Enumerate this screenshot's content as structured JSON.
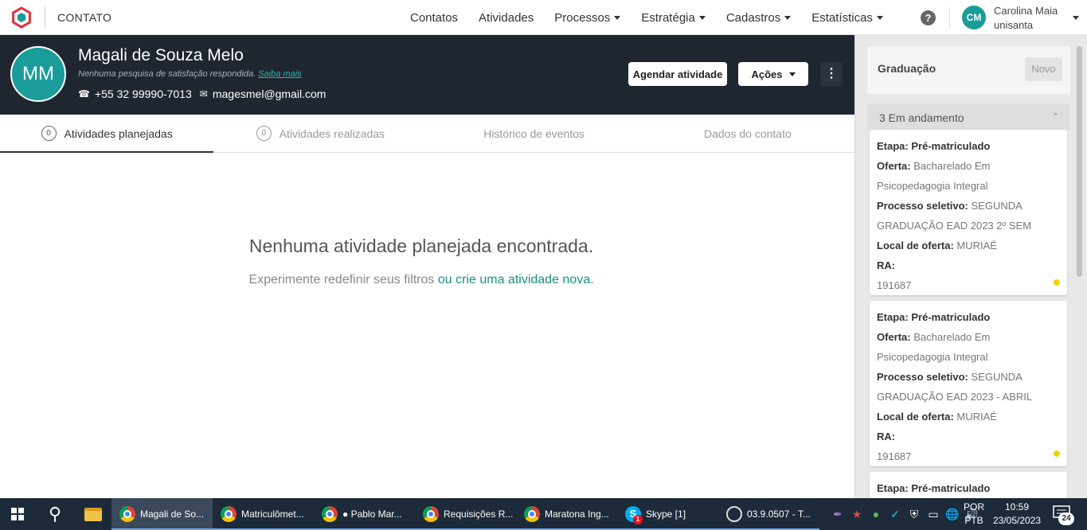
{
  "app": {
    "title": "CONTATO"
  },
  "nav": {
    "items": [
      {
        "label": "Contatos",
        "has_caret": false
      },
      {
        "label": "Atividades",
        "has_caret": false
      },
      {
        "label": "Processos",
        "has_caret": true
      },
      {
        "label": "Estratégia",
        "has_caret": true
      },
      {
        "label": "Cadastros",
        "has_caret": true
      },
      {
        "label": "Estatísticas",
        "has_caret": true
      }
    ],
    "help_glyph": "?"
  },
  "user": {
    "initials": "CM",
    "name": "Carolina Maia",
    "org": "unisanta"
  },
  "contact": {
    "initials": "MM",
    "name": "Magali de Souza Melo",
    "survey_text": "Nenhuma pesquisa de satisfação respondida.",
    "survey_link": "Saiba mais",
    "phone": "+55 32 99990-7013",
    "email": "magesmel@gmail.com",
    "schedule_button": "Agendar atividade",
    "actions_button": "Ações"
  },
  "tabs": [
    {
      "count": "0",
      "label": "Atividades planejadas",
      "active": true
    },
    {
      "count": "0",
      "label": "Atividades realizadas",
      "active": false
    },
    {
      "count": "",
      "label": "Histórico de eventos",
      "active": false
    },
    {
      "count": "",
      "label": "Dados do contato",
      "active": false
    }
  ],
  "empty_state": {
    "title": "Nenhuma atividade planejada encontrada.",
    "subtitle": "Experimente redefinir seus filtros",
    "link": "ou crie uma atividade nova."
  },
  "panel": {
    "title": "Graduação",
    "new_button": "Novo",
    "status": "3 Em andamento",
    "cards": [
      {
        "stage_label": "Etapa:",
        "stage": "Pré-matriculado",
        "offer_label": "Oferta:",
        "offer": "Bacharelado Em Psicopedagogia Integral",
        "process_label": "Processo seletivo:",
        "process": "SEGUNDA GRADUAÇÃO EAD 2023 2º SEM",
        "place_label": "Local de oferta:",
        "place": "MURIAÉ",
        "ra_label": "RA:",
        "ra": "191687"
      },
      {
        "stage_label": "Etapa:",
        "stage": "Pré-matriculado",
        "offer_label": "Oferta:",
        "offer": "Bacharelado Em Psicopedagogia Integral",
        "process_label": "Processo seletivo:",
        "process": "SEGUNDA GRADUAÇÃO EAD 2023 - ABRIL",
        "place_label": "Local de oferta:",
        "place": "MURIAÉ",
        "ra_label": "RA:",
        "ra": "191687"
      },
      {
        "stage_label": "Etapa:",
        "stage": "Pré-matriculado"
      }
    ]
  },
  "taskbar": {
    "apps": [
      {
        "icon": "chrome-icon",
        "label": "Magali de So...",
        "active": true
      },
      {
        "icon": "chrome-icon",
        "label": "Matriculômet...",
        "active": false
      },
      {
        "icon": "chrome-icon",
        "label": "● Pablo Mar...",
        "active": false
      },
      {
        "icon": "chrome-icon",
        "label": "Requisições R...",
        "active": false
      },
      {
        "icon": "chrome-icon",
        "label": "Maratona Ing...",
        "active": false
      },
      {
        "icon": "skype-icon",
        "label": "Skype [1]",
        "active": false,
        "badge": "1"
      },
      {
        "icon": "obs-icon",
        "label": "03.9.0507 - T...",
        "active": false
      }
    ],
    "lang_top": "POR",
    "lang_bottom": "PTB",
    "time": "10:59",
    "date": "23/05/2023",
    "notifications": "24"
  },
  "colors": {
    "accent": "#1a9d9a",
    "header_bg": "#1f2630",
    "status_dot": "#f2d200",
    "taskbar": "#1c2a3a"
  }
}
